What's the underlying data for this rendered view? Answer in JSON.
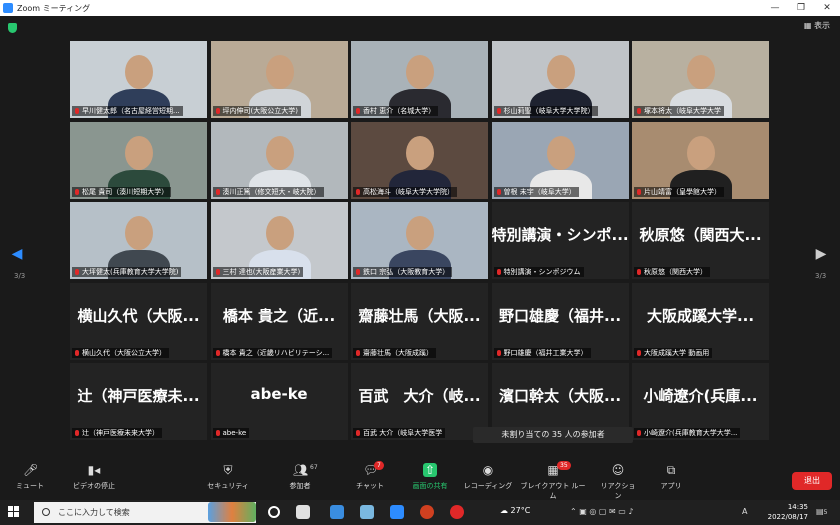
{
  "window": {
    "title": "Zoom ミーティング",
    "controls": [
      "—",
      "❐",
      "✕"
    ]
  },
  "view_label": "表示",
  "page_indicator": {
    "left": "3/3",
    "right": "3/3"
  },
  "tiles": [
    {
      "name": "早川健太郎（名古屋経営短期...",
      "type": "video"
    },
    {
      "name": "坪内伸司(大阪公立大学)",
      "type": "video"
    },
    {
      "name": "香村 恵介（名城大学）",
      "type": "video"
    },
    {
      "name": "杉山莉聖（岐阜大学大学院）",
      "type": "video"
    },
    {
      "name": "塚本将太（岐阜大学大学",
      "type": "video"
    },
    {
      "name": "松尾 貴司（湊川短期大学）",
      "type": "video"
    },
    {
      "name": "湊川正篤（修文短大・岐大院）",
      "type": "video"
    },
    {
      "name": "高松海斗（岐阜大学大学院）",
      "type": "video"
    },
    {
      "name": "曽根 未宇（岐阜大学）",
      "type": "video"
    },
    {
      "name": "片山靖富（皇學館大学）",
      "type": "video"
    },
    {
      "name": "大坪健太(兵庫教育大学大学院)",
      "type": "video"
    },
    {
      "name": "三村 達也(大阪産業大学)",
      "type": "video"
    },
    {
      "name": "鉄口 宗弘（大阪教育大学）",
      "type": "video"
    },
    {
      "name": "特別講演・シンポジウム",
      "display": "特別講演・シンポ...",
      "type": "text"
    },
    {
      "name": "秋原悠（関西大学）",
      "display": "秋原悠（関西大...",
      "type": "text"
    },
    {
      "name": "横山久代（大阪公立大学）",
      "display": "横山久代（大阪...",
      "type": "text"
    },
    {
      "name": "橋本 貴之（近畿リハビリテーシ...",
      "display": "橋本 貴之（近...",
      "type": "text"
    },
    {
      "name": "齋藤壮馬（大阪成蹊）",
      "display": "齋藤壮馬（大阪...",
      "type": "text"
    },
    {
      "name": "野口雄慶（福井工業大学）",
      "display": "野口雄慶（福井...",
      "type": "text"
    },
    {
      "name": "大阪成蹊大学 動画用",
      "display": "大阪成蹊大学...",
      "type": "text"
    },
    {
      "name": "辻（神戸医療未来大学）",
      "display": "辻（神戸医療未...",
      "type": "text"
    },
    {
      "name": "abe-ke",
      "display": "abe-ke",
      "type": "text"
    },
    {
      "name": "百武 大介（岐阜大学医学",
      "display": "百武　大介（岐...",
      "type": "text"
    },
    {
      "name": "",
      "display": "濱口幹太（大阪...",
      "type": "text"
    },
    {
      "name": "小崎遼介(兵庫教育大学大学...",
      "display": "小崎遼介(兵庫...",
      "type": "text"
    }
  ],
  "unassigned_popup": "未割り当ての 35 人の参加者",
  "toolbar": {
    "items": [
      {
        "label": "ミュート",
        "icon": "mic-icon"
      },
      {
        "label": "ビデオの停止",
        "icon": "video-icon"
      },
      {
        "label": "セキュリティ",
        "icon": "shield-icon"
      },
      {
        "label": "参加者",
        "icon": "participants-icon",
        "count": "67"
      },
      {
        "label": "チャット",
        "icon": "chat-icon",
        "badge": "7"
      },
      {
        "label": "画面の共有",
        "icon": "share-screen-icon"
      },
      {
        "label": "レコーディング",
        "icon": "record-icon"
      },
      {
        "label": "ブレイクアウト ルーム",
        "icon": "breakout-icon",
        "badge": "35"
      },
      {
        "label": "リアクション",
        "icon": "reaction-icon"
      },
      {
        "label": "アプリ",
        "icon": "apps-icon"
      }
    ],
    "leave": "退出"
  },
  "taskbar": {
    "search_placeholder": "ここに入力して検索",
    "weather": "27°C",
    "time": "14:35",
    "date": "2022/08/17",
    "ime": "A",
    "notify_count": "5"
  },
  "colors": {
    "accent": "#2d8cff",
    "danger": "#e02828",
    "share_green": "#28c76f"
  }
}
